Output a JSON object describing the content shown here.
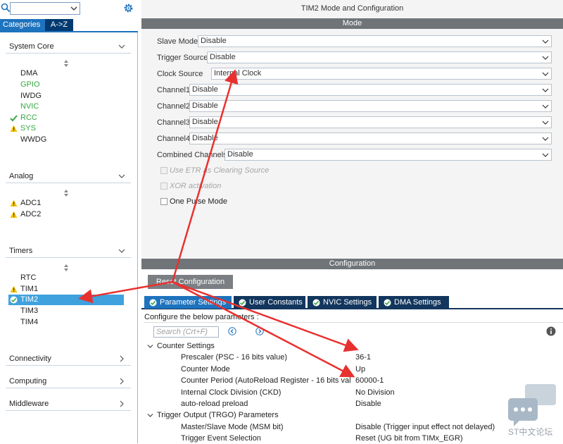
{
  "left": {
    "tabs": {
      "categories": "Categories",
      "az": "A->Z"
    },
    "sections": [
      {
        "title": "System Core",
        "items": [
          {
            "label": "DMA",
            "state": "normal"
          },
          {
            "label": "GPIO",
            "state": "green"
          },
          {
            "label": "IWDG",
            "state": "normal"
          },
          {
            "label": "NVIC",
            "state": "green"
          },
          {
            "label": "RCC",
            "state": "check"
          },
          {
            "label": "SYS",
            "state": "warn"
          },
          {
            "label": "WWDG",
            "state": "normal"
          }
        ]
      },
      {
        "title": "Analog",
        "items": [
          {
            "label": "ADC1",
            "state": "warn"
          },
          {
            "label": "ADC2",
            "state": "warn"
          }
        ]
      },
      {
        "title": "Timers",
        "items": [
          {
            "label": "RTC",
            "state": "normal"
          },
          {
            "label": "TIM1",
            "state": "warn"
          },
          {
            "label": "TIM2",
            "state": "selected"
          },
          {
            "label": "TIM3",
            "state": "normal"
          },
          {
            "label": "TIM4",
            "state": "normal"
          }
        ]
      },
      {
        "title": "Connectivity"
      },
      {
        "title": "Computing"
      },
      {
        "title": "Middleware"
      }
    ]
  },
  "right": {
    "title": "TIM2 Mode and Configuration",
    "mode_header": "Mode",
    "mode_rows": [
      {
        "label": "Slave Mode",
        "value": "Disable"
      },
      {
        "label": "Trigger Source",
        "value": "Disable"
      },
      {
        "label": "Clock Source",
        "value": "Internal Clock"
      },
      {
        "label": "Channel1",
        "value": "Disable"
      },
      {
        "label": "Channel2",
        "value": "Disable"
      },
      {
        "label": "Channel3",
        "value": "Disable"
      },
      {
        "label": "Channel4",
        "value": "Disable"
      },
      {
        "label": "Combined Channels",
        "value": "Disable"
      }
    ],
    "checkboxes": [
      {
        "label": "Use ETR as Clearing Source",
        "enabled": false
      },
      {
        "label": "XOR activation",
        "enabled": false
      },
      {
        "label": "One Pulse Mode",
        "enabled": true
      }
    ],
    "config_header": "Configuration",
    "reset_button": "Reset Configuration",
    "param_tabs": [
      "Parameter Settings",
      "User Constants",
      "NVIC Settings",
      "DMA Settings"
    ],
    "configure_text": "Configure the below parameters :",
    "search_placeholder": "Search (Crt+F)",
    "groups": {
      "counter": "Counter Settings",
      "trgo": "Trigger Output (TRGO) Parameters"
    },
    "params": [
      {
        "name": "Prescaler (PSC - 16 bits value)",
        "value": "36-1"
      },
      {
        "name": "Counter Mode",
        "value": "Up"
      },
      {
        "name": "Counter Period (AutoReload Register - 16 bits val...",
        "value": "60000-1"
      },
      {
        "name": "Internal Clock Division (CKD)",
        "value": "No Division"
      },
      {
        "name": "auto-reload preload",
        "value": "Disable"
      },
      {
        "name": "Master/Slave Mode (MSM bit)",
        "value": "Disable (Trigger input effect not delayed)"
      },
      {
        "name": "Trigger Event Selection",
        "value": "Reset (UG bit from TIMx_EGR)"
      }
    ]
  },
  "watermark": "ST中文论坛",
  "colors": {
    "accent": "#1e73be",
    "green": "#36a844",
    "warn": "#f5c400",
    "annotation": "#e8312f"
  }
}
